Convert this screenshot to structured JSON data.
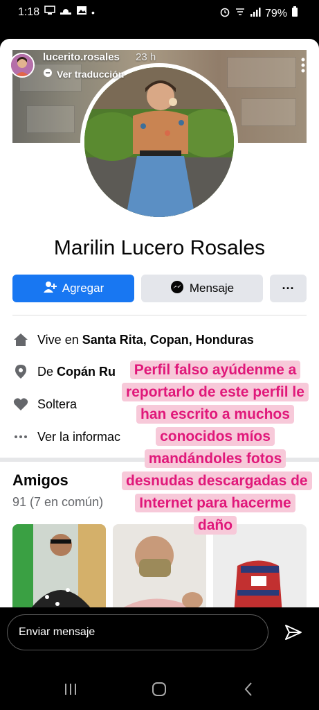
{
  "status_bar": {
    "time": "1:18",
    "battery": "79%",
    "dot": "•"
  },
  "story": {
    "username": "lucerito.rosales",
    "time_ago": "23 h",
    "translate_label": "Ver traducción"
  },
  "profile": {
    "name": "Marilin Lucero Rosales",
    "add_button": "Agregar",
    "message_button": "Mensaje",
    "more_button": "···"
  },
  "info": {
    "lives_prefix": "Vive en ",
    "lives_place": "Santa Rita, Copan, Honduras",
    "from_prefix": "De ",
    "from_place": "Copán Ru",
    "relationship": "Soltera",
    "see_more": "Ver la informac"
  },
  "friends": {
    "title": "Amigos",
    "count": "91 (7 en común)"
  },
  "overlay": {
    "text": "Perfil falso ayúdenme a reportarlo de este perfil le han escrito a muchos conocidos míos mandándoles fotos desnudas descargadas de Internet para hacerme daño"
  },
  "reply": {
    "placeholder": "Enviar mensaje"
  },
  "colors": {
    "facebook_blue": "#1877f2",
    "overlay_text": "#e0187a",
    "overlay_bg": "#f7c9d9"
  }
}
